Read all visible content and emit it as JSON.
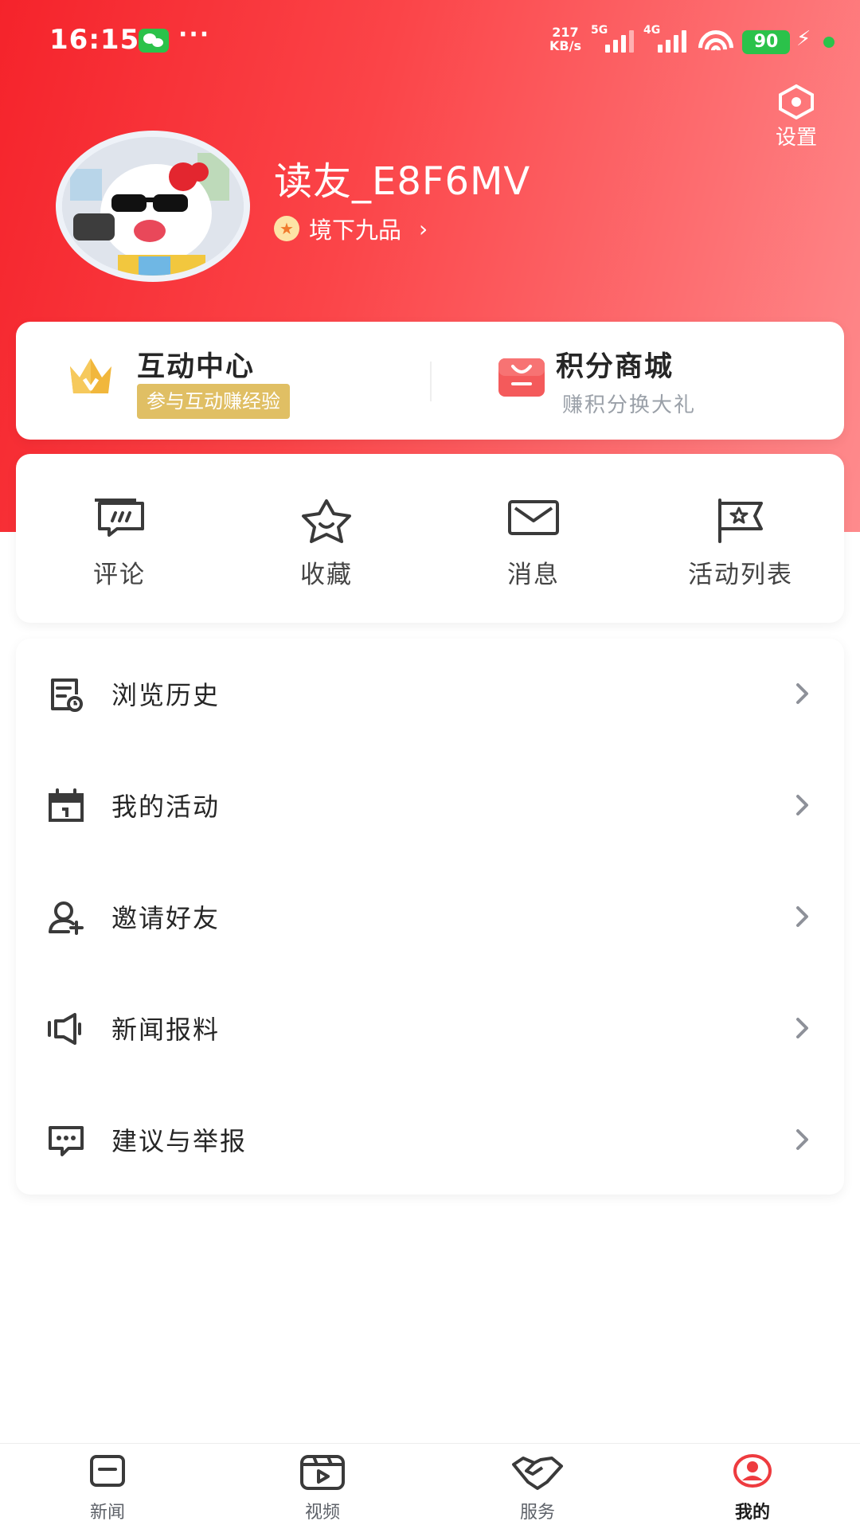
{
  "status_bar": {
    "time": "16:15",
    "dots": "···",
    "speed_value": "217",
    "speed_unit": "KB/s",
    "net1": "5G",
    "net2": "4G",
    "battery": "90",
    "icons": [
      "wechat-icon",
      "signal-icon",
      "wifi-icon",
      "battery-icon",
      "charging-icon"
    ]
  },
  "header": {
    "settings_label": "设置",
    "username": "读友_E8F6MV",
    "level": "境下九品",
    "colors": {
      "gradient_start": "#f5232b",
      "gradient_end": "#fe8b8d"
    }
  },
  "top_card": {
    "interaction": {
      "title": "互动中心",
      "badge": "参与互动赚经验",
      "icon": "crown-icon"
    },
    "mall": {
      "title": "积分商城",
      "subtitle": "赚积分换大礼",
      "icon": "shopping-bag-icon"
    }
  },
  "quick_actions": [
    {
      "label": "评论",
      "icon": "comment-icon"
    },
    {
      "label": "收藏",
      "icon": "star-icon"
    },
    {
      "label": "消息",
      "icon": "mail-icon"
    },
    {
      "label": "活动列表",
      "icon": "flag-icon"
    }
  ],
  "menu": [
    {
      "label": "浏览历史",
      "icon": "history-icon"
    },
    {
      "label": "我的活动",
      "icon": "calendar-icon"
    },
    {
      "label": "邀请好友",
      "icon": "add-user-icon"
    },
    {
      "label": "新闻报料",
      "icon": "megaphone-icon"
    },
    {
      "label": "建议与举报",
      "icon": "feedback-icon"
    }
  ],
  "tabs": [
    {
      "label": "新闻",
      "icon": "news-icon"
    },
    {
      "label": "视频",
      "icon": "video-icon"
    },
    {
      "label": "服务",
      "icon": "handshake-icon"
    },
    {
      "label": "我的",
      "icon": "profile-icon",
      "active": true,
      "active_color": "#ee3b3f"
    }
  ]
}
